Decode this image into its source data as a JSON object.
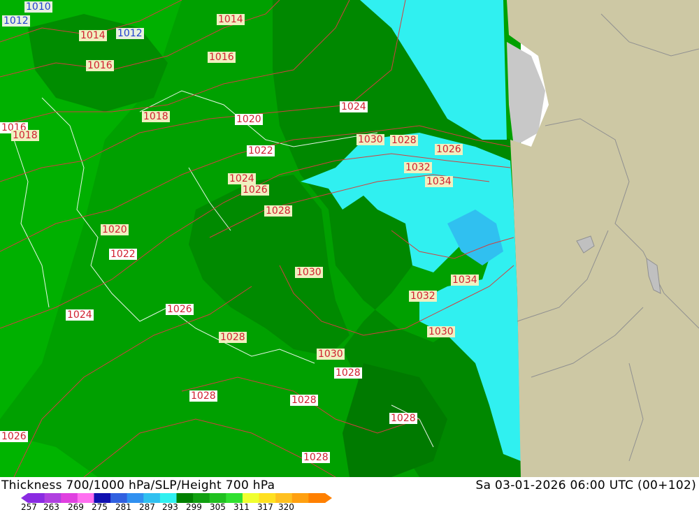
{
  "title": "Thickness 700/1000 hPa/SLP/Height 700 hPa",
  "datetime": "Sa 03-01-2026 06:00 UTC (00+102)",
  "colorbar": {
    "ticks": [
      "257",
      "263",
      "269",
      "275",
      "281",
      "287",
      "293",
      "299",
      "305",
      "311",
      "317",
      "320"
    ],
    "colors": [
      "#8a2be2",
      "#b040e0",
      "#e040e0",
      "#ff70f0",
      "#1010b0",
      "#3060e0",
      "#3090f0",
      "#30c0f0",
      "#30f0f0",
      "#008000",
      "#10a010",
      "#20c020",
      "#30e030",
      "#f0ff30",
      "#ffe020",
      "#ffc020",
      "#ffa010",
      "#ff8000"
    ]
  },
  "isobars": [
    {
      "label": "1010",
      "color": "blue"
    },
    {
      "label": "1012",
      "color": "blue"
    },
    {
      "label": "1012",
      "color": "blue"
    },
    {
      "label": "1014",
      "color": "red"
    },
    {
      "label": "1014",
      "color": "red"
    },
    {
      "label": "1016",
      "color": "red"
    },
    {
      "label": "1016",
      "color": "red"
    },
    {
      "label": "1016",
      "color": "red"
    },
    {
      "label": "1018",
      "color": "red"
    },
    {
      "label": "1018",
      "color": "red"
    },
    {
      "label": "1020",
      "color": "red"
    },
    {
      "label": "1020",
      "color": "red"
    },
    {
      "label": "1022",
      "color": "red"
    },
    {
      "label": "1022",
      "color": "red"
    },
    {
      "label": "1024",
      "color": "red"
    },
    {
      "label": "1024",
      "color": "red"
    },
    {
      "label": "1024",
      "color": "red"
    },
    {
      "label": "1026",
      "color": "red"
    },
    {
      "label": "1026",
      "color": "red"
    },
    {
      "label": "1026",
      "color": "red"
    },
    {
      "label": "1026",
      "color": "red"
    },
    {
      "label": "1028",
      "color": "red"
    },
    {
      "label": "1028",
      "color": "red"
    },
    {
      "label": "1028",
      "color": "red"
    },
    {
      "label": "1028",
      "color": "red"
    },
    {
      "label": "1028",
      "color": "red"
    },
    {
      "label": "1028",
      "color": "red"
    },
    {
      "label": "1028",
      "color": "red"
    },
    {
      "label": "1030",
      "color": "red"
    },
    {
      "label": "1030",
      "color": "red"
    },
    {
      "label": "1030",
      "color": "red"
    },
    {
      "label": "1030",
      "color": "red"
    },
    {
      "label": "1032",
      "color": "red"
    },
    {
      "label": "1032",
      "color": "red"
    },
    {
      "label": "1034",
      "color": "red"
    },
    {
      "label": "1034",
      "color": "red"
    }
  ]
}
